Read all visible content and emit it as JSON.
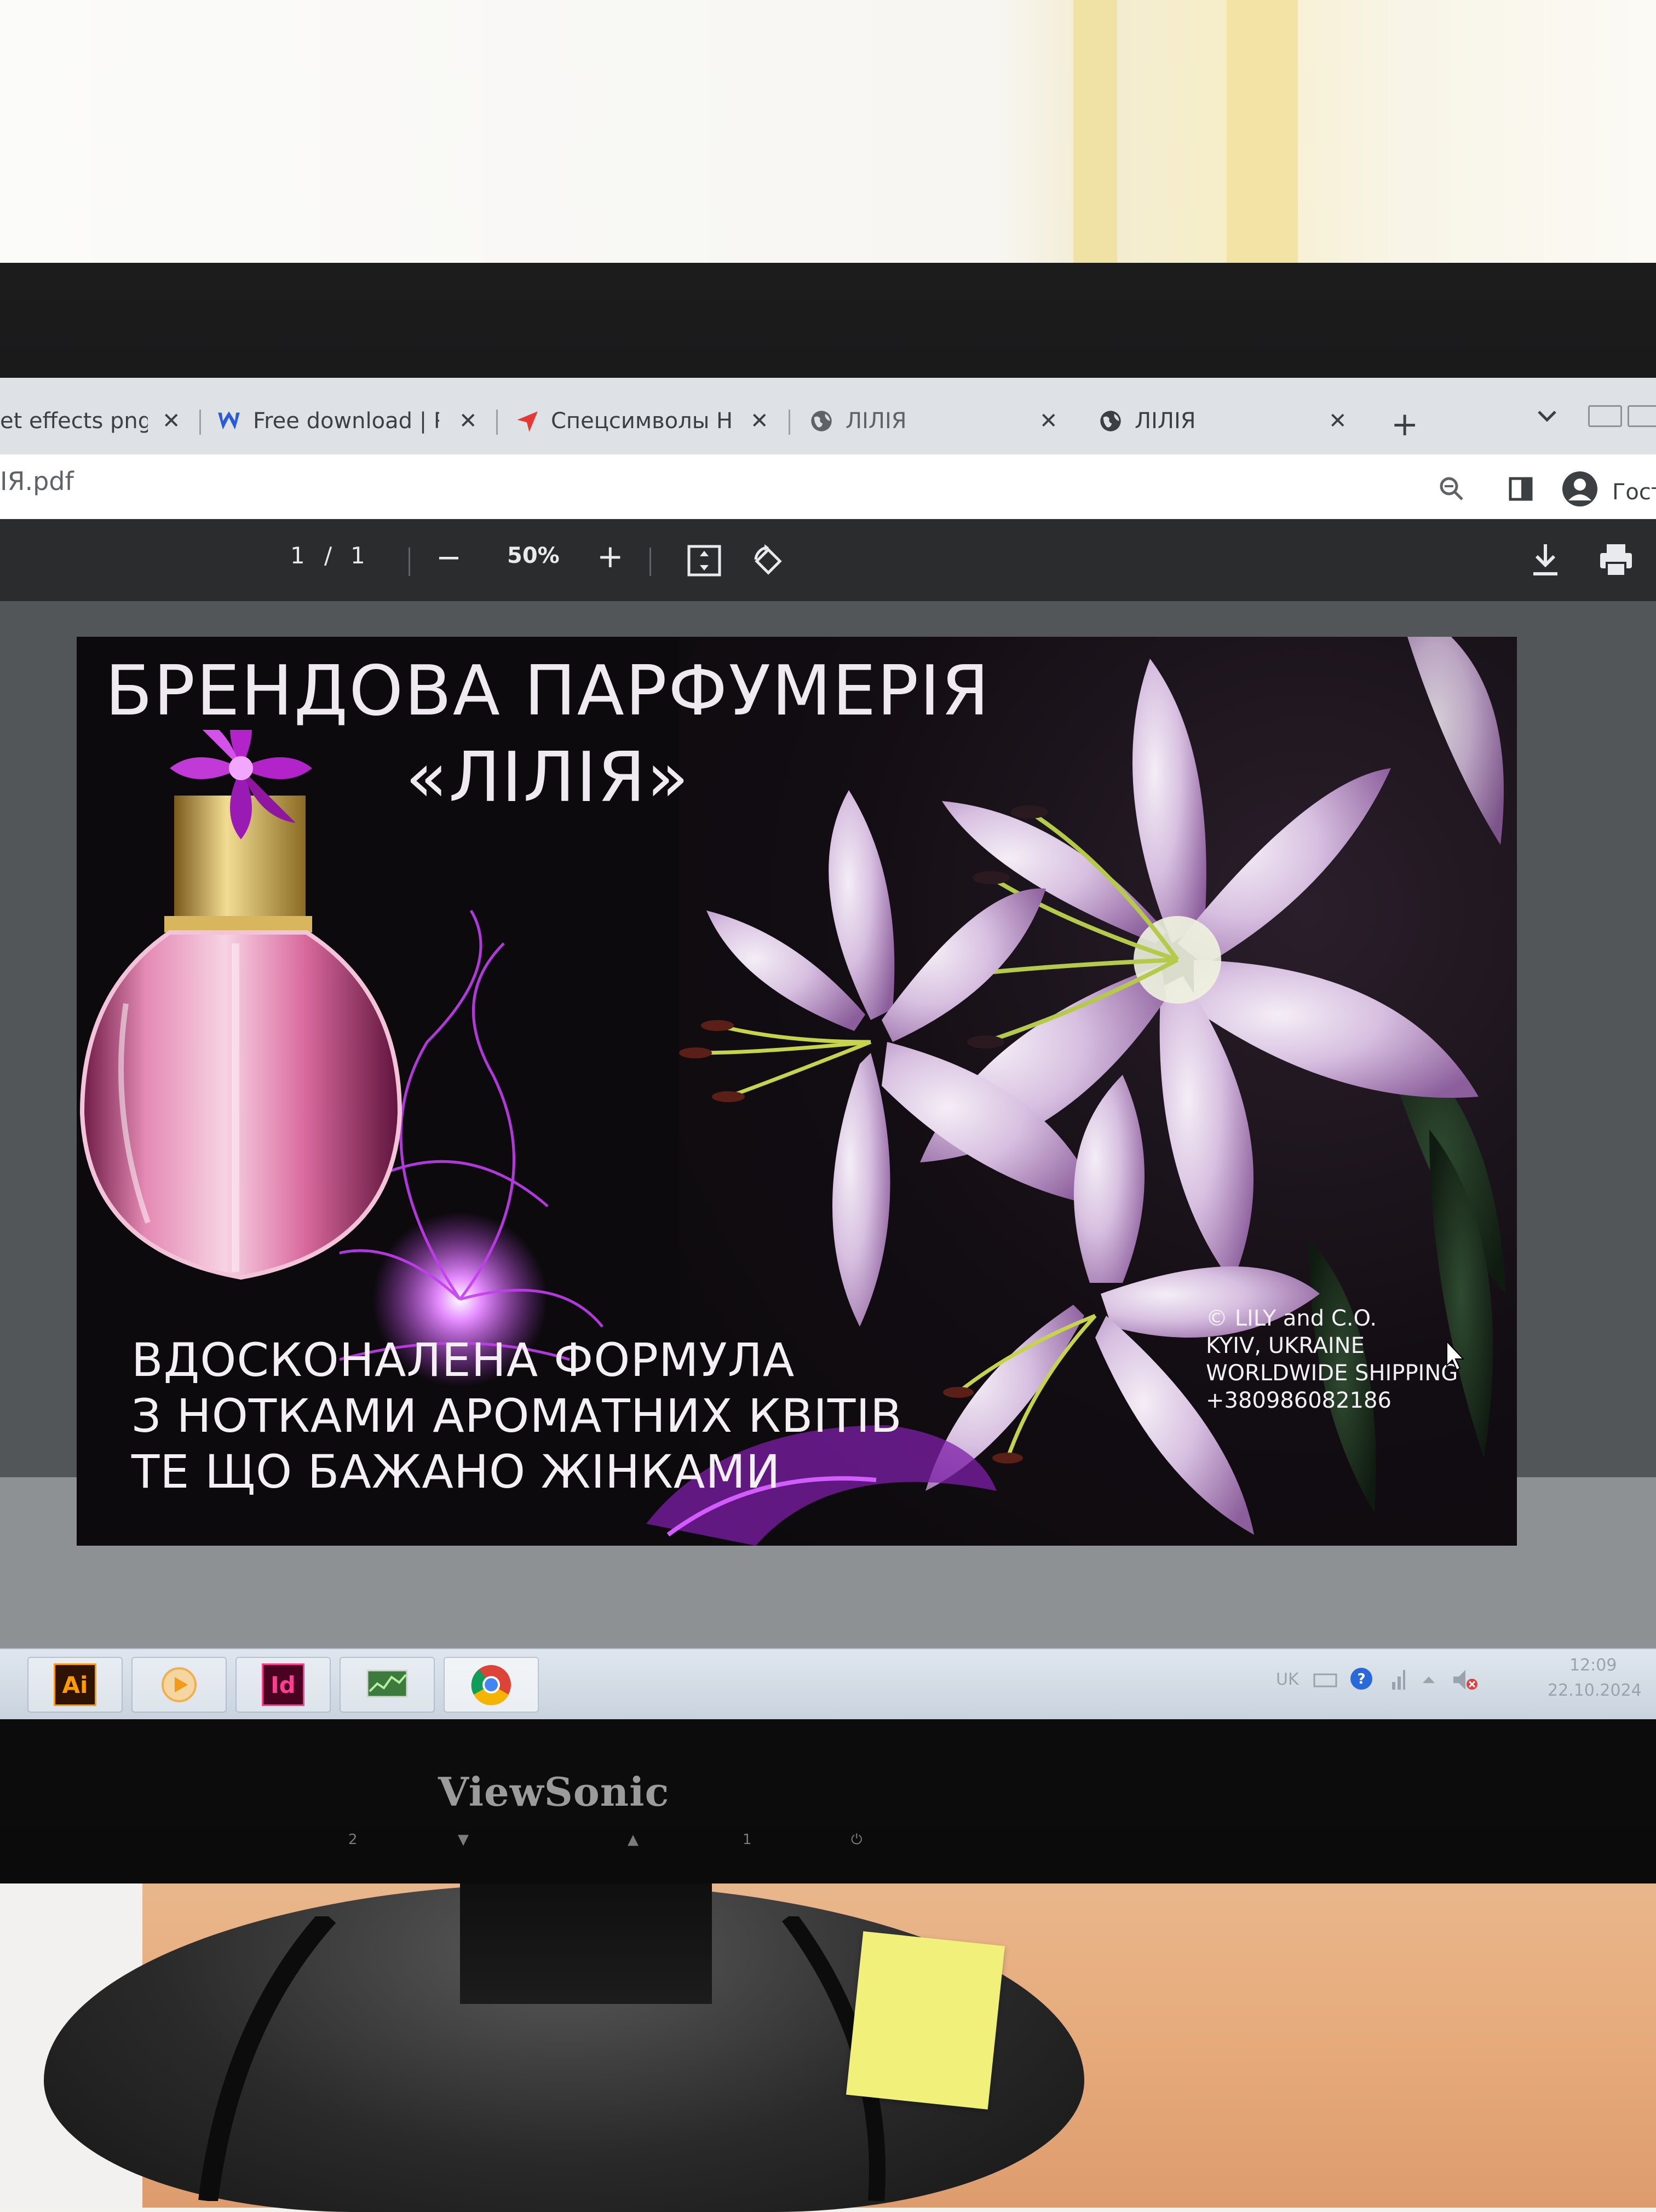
{
  "browser": {
    "tabs": [
      {
        "label": "et effects png -",
        "icon": "page-icon"
      },
      {
        "label": "Free download | Pu",
        "icon": "w-logo-icon"
      },
      {
        "label": "Спецсимволы HTI",
        "icon": "red-arrow-icon"
      },
      {
        "label": "ЛІЛІЯ",
        "icon": "globe-icon"
      },
      {
        "label": "ЛІЛІЯ",
        "icon": "globe-icon"
      }
    ],
    "new_tab": "+",
    "close_glyph": "✕",
    "url_text": "ІЯ.pdf",
    "profile_label": "Гост"
  },
  "pdf_toolbar": {
    "page_current": "1",
    "page_sep": "/",
    "page_total": "1",
    "zoom_out": "−",
    "zoom_level": "50%",
    "zoom_in": "+"
  },
  "poster": {
    "title_line1": "БРЕНДОВА ПАРФУМЕРІЯ",
    "title_line2": "«ЛІЛІЯ»",
    "slogan": [
      "ВДОСКОНАЛЕНА ФОРМУЛА",
      "З НОТКАМИ АРОМАТНИХ КВІТІВ",
      "ТЕ ЩО БАЖАНО ЖІНКАМИ"
    ],
    "contacts": [
      "© LILY and C.O.",
      "KYIV, UKRAINE",
      "WORLDWIDE SHIPPING",
      "+380986082186"
    ]
  },
  "taskbar": {
    "apps": [
      {
        "label": "Ai",
        "color": "#2e1300",
        "text_color": "#ff9a00"
      },
      {
        "label": "",
        "color": "#f5d6a0"
      },
      {
        "label": "Id",
        "color": "#49021f",
        "text_color": "#ff3d93"
      },
      {
        "label": "",
        "color": "#3d7a3d"
      },
      {
        "label": "",
        "color": "#ffffff"
      }
    ],
    "lang": "UK",
    "time": "12:09",
    "date": "22.10.2024"
  },
  "monitor": {
    "brand": "ViewSonic",
    "buttons": [
      "2",
      "▼",
      "▲",
      "1",
      "⏻"
    ]
  },
  "colors": {
    "pdf_toolbar": "#2b2c2e",
    "pdf_bg": "#525659",
    "poster_bg": "#0c0a0d",
    "lily_petal": "#d7bfe0",
    "lily_center": "#eef3df",
    "magenta_glow": "#c33ef0"
  }
}
